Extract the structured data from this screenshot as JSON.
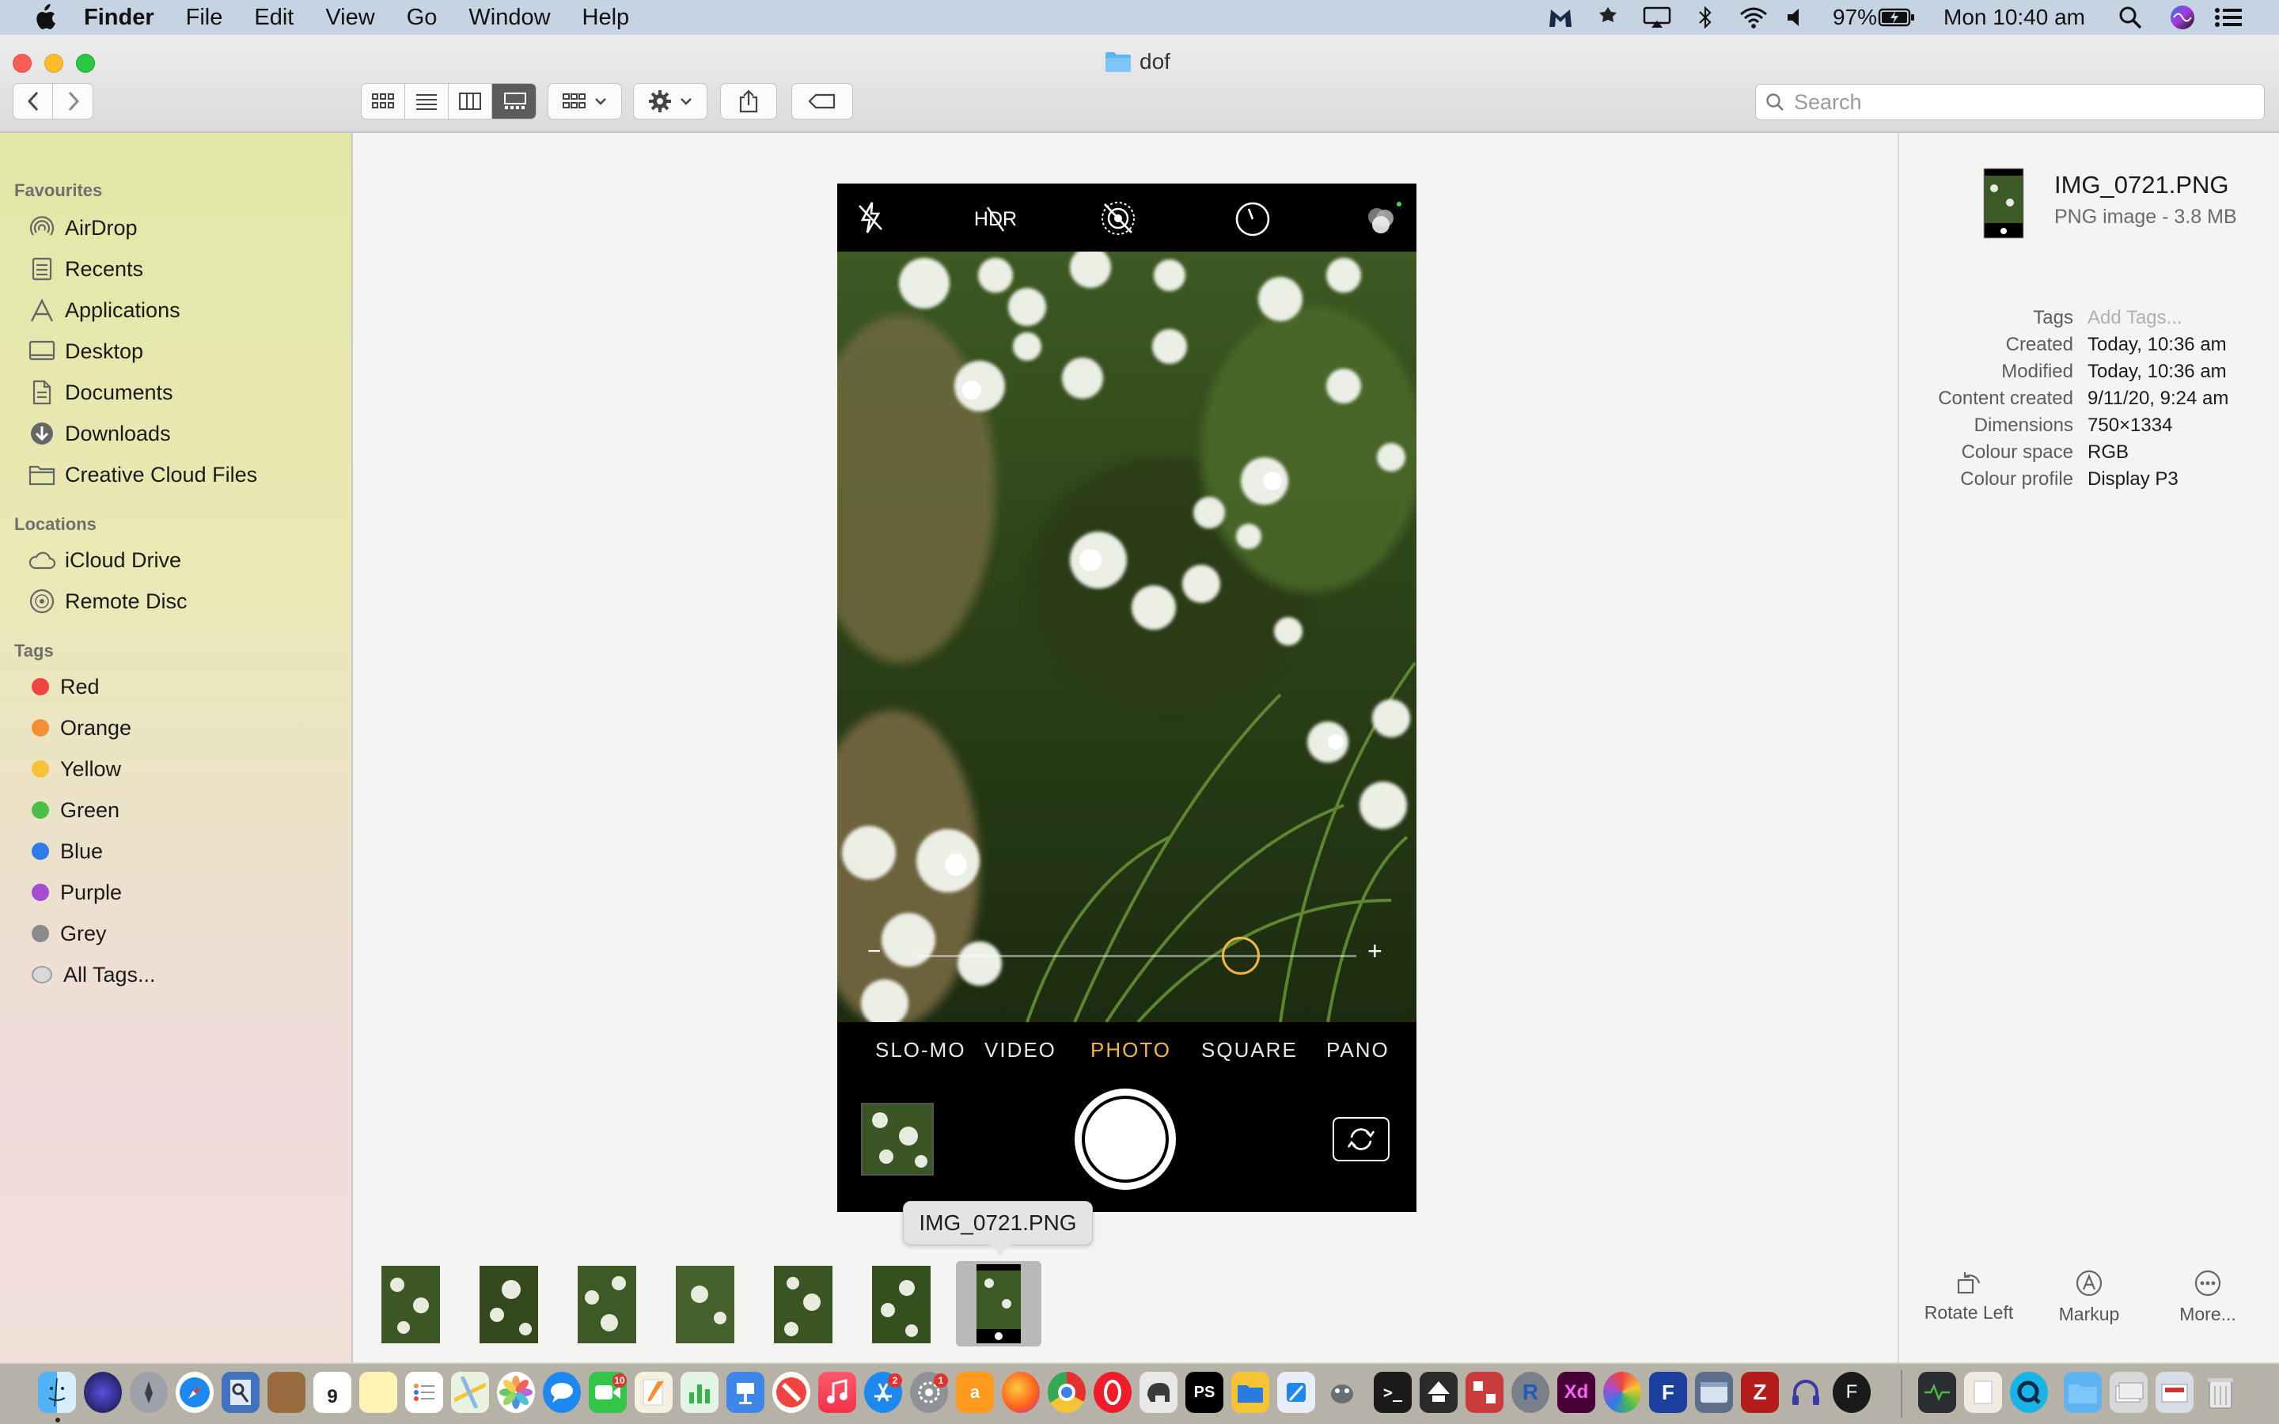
{
  "menubar": {
    "app_name": "Finder",
    "menus": [
      "File",
      "Edit",
      "View",
      "Go",
      "Window",
      "Help"
    ],
    "battery": "97%",
    "clock": "Mon 10:40 am"
  },
  "window": {
    "title": "dof",
    "search_placeholder": "Search"
  },
  "sidebar": {
    "favourites_heading": "Favourites",
    "favourites": [
      "AirDrop",
      "Recents",
      "Applications",
      "Desktop",
      "Documents",
      "Downloads",
      "Creative Cloud Files"
    ],
    "locations_heading": "Locations",
    "locations": [
      "iCloud Drive",
      "Remote Disc"
    ],
    "tags_heading": "Tags",
    "tags": [
      {
        "label": "Red",
        "color": "#f0453f"
      },
      {
        "label": "Orange",
        "color": "#f39035"
      },
      {
        "label": "Yellow",
        "color": "#f5c434"
      },
      {
        "label": "Green",
        "color": "#4bbf45"
      },
      {
        "label": "Blue",
        "color": "#2f7be8"
      },
      {
        "label": "Purple",
        "color": "#a64cd1"
      },
      {
        "label": "Grey",
        "color": "#8a8a8a"
      }
    ],
    "all_tags": "All Tags..."
  },
  "preview": {
    "camera_modes": [
      "SLO-MO",
      "VIDEO",
      "PHOTO",
      "SQUARE",
      "PANO"
    ],
    "active_mode": "PHOTO",
    "accent_color": "#f3b73d",
    "zoom_minus": "−",
    "zoom_plus": "+",
    "exposure_level": 0.74
  },
  "tooltip": "IMG_0721.PNG",
  "filmstrip": {
    "count": 7,
    "selected_index": 6
  },
  "inspector": {
    "file_name": "IMG_0721.PNG",
    "file_kind": "PNG image - 3.8 MB",
    "rows": [
      {
        "label": "Tags",
        "value": "Add Tags..."
      },
      {
        "label": "Created",
        "value": "Today, 10:36 am"
      },
      {
        "label": "Modified",
        "value": "Today, 10:36 am"
      },
      {
        "label": "Content created",
        "value": "9/11/20, 9:24 am"
      },
      {
        "label": "Dimensions",
        "value": "750×1334"
      },
      {
        "label": "Colour space",
        "value": "RGB"
      },
      {
        "label": "Colour profile",
        "value": "Display P3"
      }
    ],
    "actions": [
      "Rotate Left",
      "Markup",
      "More..."
    ]
  }
}
